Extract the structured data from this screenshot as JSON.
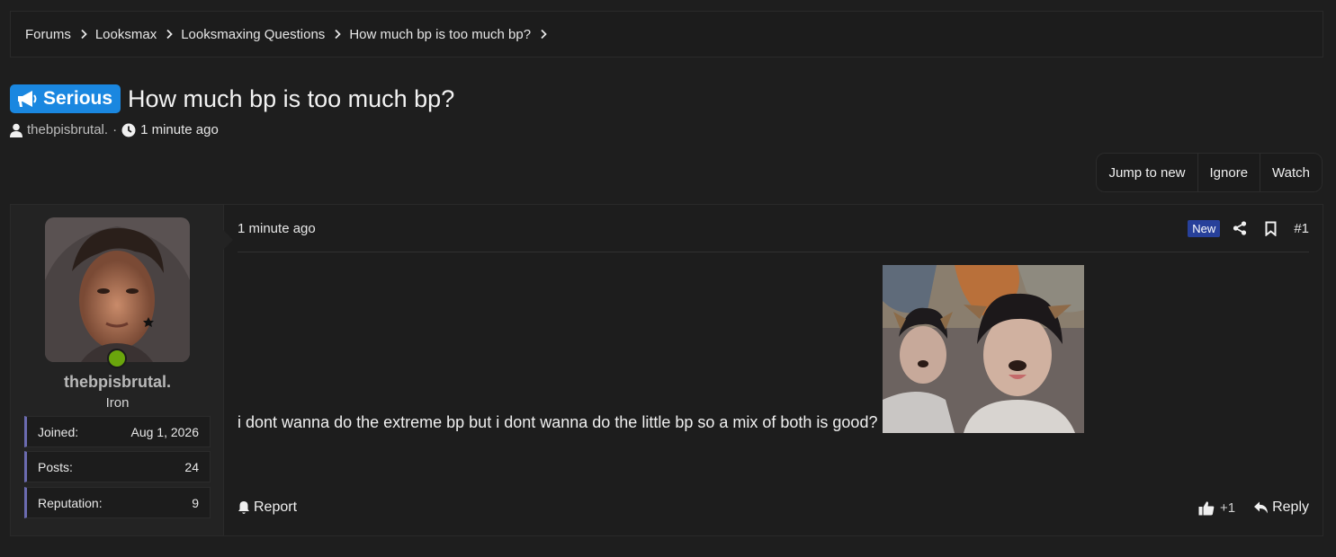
{
  "breadcrumb": [
    "Forums",
    "Looksmax",
    "Looksmaxing Questions",
    "How much bp is too much bp?"
  ],
  "thread": {
    "prefix": "Serious",
    "title": "How much bp is too much bp?",
    "author": "thebpisbrutal.",
    "separator": "·",
    "time": "1 minute ago"
  },
  "actions": {
    "jump_to_new": "Jump to new",
    "ignore": "Ignore",
    "watch": "Watch"
  },
  "user": {
    "name": "thebpisbrutal.",
    "rank": "Iron",
    "stats": [
      {
        "label": "Joined:",
        "value": "Aug 1, 2026"
      },
      {
        "label": "Posts:",
        "value": "24"
      },
      {
        "label": "Reputation:",
        "value": "9"
      }
    ]
  },
  "post": {
    "time": "1 minute ago",
    "badge": "New",
    "number": "#1",
    "text": "i dont wanna do the extreme bp but i dont wanna do the little bp so a mix of both is good?",
    "report": "Report",
    "reaction_count": "+1",
    "reply": "Reply"
  },
  "colors": {
    "background": "#1e1e1e",
    "prefix_badge": "#1a87e0",
    "new_badge": "#27409a",
    "online": "#6aa50c",
    "stat_accent": "#6b6bb0"
  },
  "icons": [
    "chevron-right-icon",
    "megaphone-icon",
    "user-icon",
    "clock-icon",
    "share-icon",
    "bookmark-icon",
    "bell-icon",
    "thumbs-up-icon",
    "reply-icon"
  ]
}
